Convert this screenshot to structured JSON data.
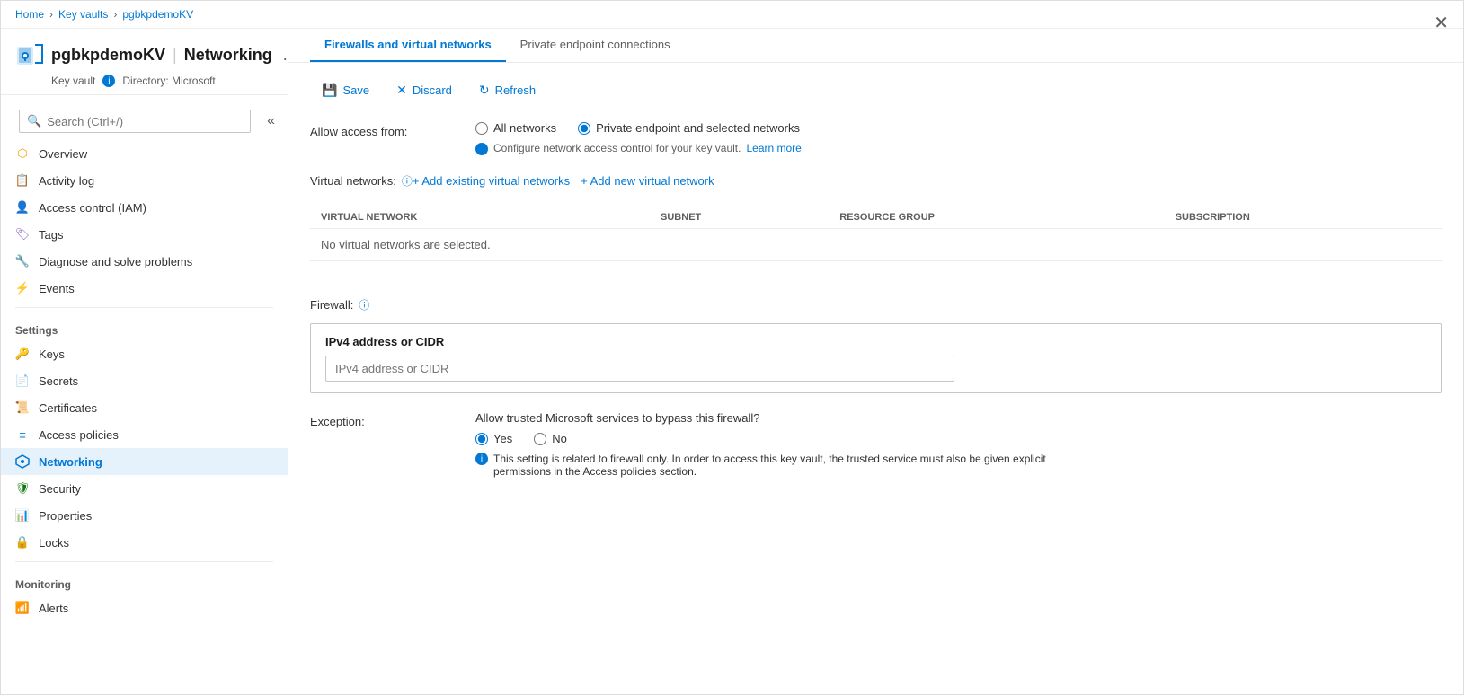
{
  "breadcrumb": {
    "home": "Home",
    "keyvaults": "Key vaults",
    "resource": "pgbkpdemoKV"
  },
  "resource": {
    "name": "pgbkpdemoKV",
    "separator": "|",
    "page": "Networking",
    "type": "Key vault",
    "directory_label": "Directory: Microsoft",
    "ellipsis": "..."
  },
  "search": {
    "placeholder": "Search (Ctrl+/)"
  },
  "sidebar": {
    "nav_items": [
      {
        "id": "overview",
        "label": "Overview",
        "icon": "overview"
      },
      {
        "id": "activity-log",
        "label": "Activity log",
        "icon": "activity"
      },
      {
        "id": "access-control",
        "label": "Access control (IAM)",
        "icon": "iam"
      },
      {
        "id": "tags",
        "label": "Tags",
        "icon": "tags"
      },
      {
        "id": "diagnose",
        "label": "Diagnose and solve problems",
        "icon": "diagnose"
      },
      {
        "id": "events",
        "label": "Events",
        "icon": "events"
      }
    ],
    "settings_label": "Settings",
    "settings_items": [
      {
        "id": "keys",
        "label": "Keys",
        "icon": "keys"
      },
      {
        "id": "secrets",
        "label": "Secrets",
        "icon": "secrets"
      },
      {
        "id": "certificates",
        "label": "Certificates",
        "icon": "certificates"
      },
      {
        "id": "access-policies",
        "label": "Access policies",
        "icon": "access-policies"
      },
      {
        "id": "networking",
        "label": "Networking",
        "icon": "networking",
        "active": true
      },
      {
        "id": "security",
        "label": "Security",
        "icon": "security"
      },
      {
        "id": "properties",
        "label": "Properties",
        "icon": "properties"
      },
      {
        "id": "locks",
        "label": "Locks",
        "icon": "locks"
      }
    ],
    "monitoring_label": "Monitoring",
    "monitoring_items": [
      {
        "id": "alerts",
        "label": "Alerts",
        "icon": "alerts"
      }
    ]
  },
  "tabs": [
    {
      "id": "firewalls",
      "label": "Firewalls and virtual networks",
      "active": true
    },
    {
      "id": "private-endpoints",
      "label": "Private endpoint connections",
      "active": false
    }
  ],
  "toolbar": {
    "save_label": "Save",
    "discard_label": "Discard",
    "refresh_label": "Refresh"
  },
  "form": {
    "allow_access_label": "Allow access from:",
    "all_networks_label": "All networks",
    "private_endpoint_label": "Private endpoint and selected networks",
    "info_text": "Configure network access control for your key vault.",
    "learn_more": "Learn more",
    "virtual_networks_label": "Virtual networks:",
    "add_existing_label": "+ Add existing virtual networks",
    "add_new_label": "+ Add new virtual network",
    "table_headers": {
      "virtual_network": "VIRTUAL NETWORK",
      "subnet": "SUBNET",
      "resource_group": "RESOURCE GROUP",
      "subscription": "SUBSCRIPTION"
    },
    "no_data_message": "No virtual networks are selected.",
    "firewall_label": "Firewall:",
    "ipv4_title": "IPv4 address or CIDR",
    "ipv4_placeholder": "IPv4 address or CIDR",
    "exception_label": "Exception:",
    "exception_question": "Allow trusted Microsoft services to bypass this firewall?",
    "yes_label": "Yes",
    "no_label": "No",
    "exception_info": "This setting is related to firewall only. In order to access this key vault, the trusted service must also be given explicit permissions in the Access policies section."
  }
}
